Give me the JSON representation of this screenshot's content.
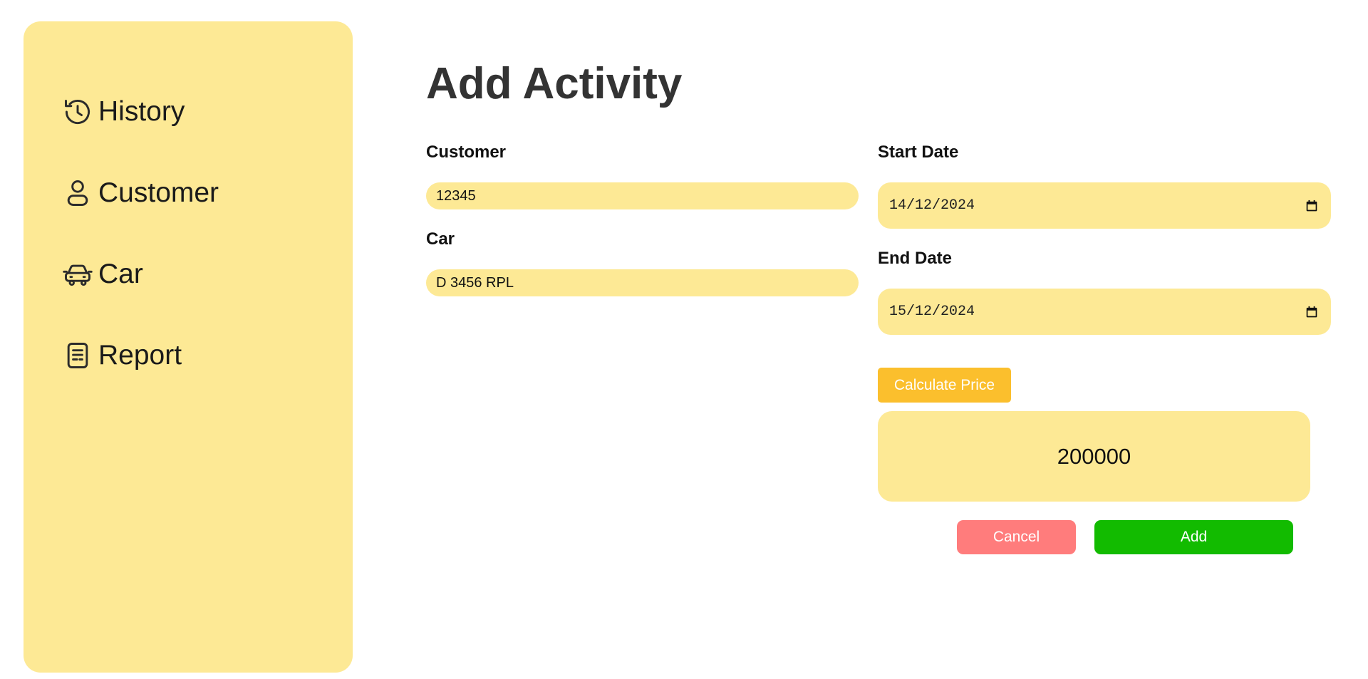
{
  "sidebar": {
    "items": [
      {
        "label": "History",
        "icon": "history-icon"
      },
      {
        "label": "Customer",
        "icon": "user-icon"
      },
      {
        "label": "Car",
        "icon": "car-icon"
      },
      {
        "label": "Report",
        "icon": "report-icon"
      }
    ]
  },
  "main": {
    "title": "Add Activity",
    "form": {
      "customer": {
        "label": "Customer",
        "value": "12345"
      },
      "car": {
        "label": "Car",
        "value": "D 3456 RPL"
      },
      "start_date": {
        "label": "Start Date",
        "value": "14/12/2024"
      },
      "end_date": {
        "label": "End Date",
        "value": "15/12/2024"
      }
    },
    "calculate_label": "Calculate Price",
    "price": "200000",
    "cancel_label": "Cancel",
    "add_label": "Add"
  },
  "colors": {
    "panel": "#fde995",
    "calculate": "#fbbf2d",
    "cancel": "#ff7c7c",
    "add": "#12bb00",
    "title": "#333333"
  }
}
